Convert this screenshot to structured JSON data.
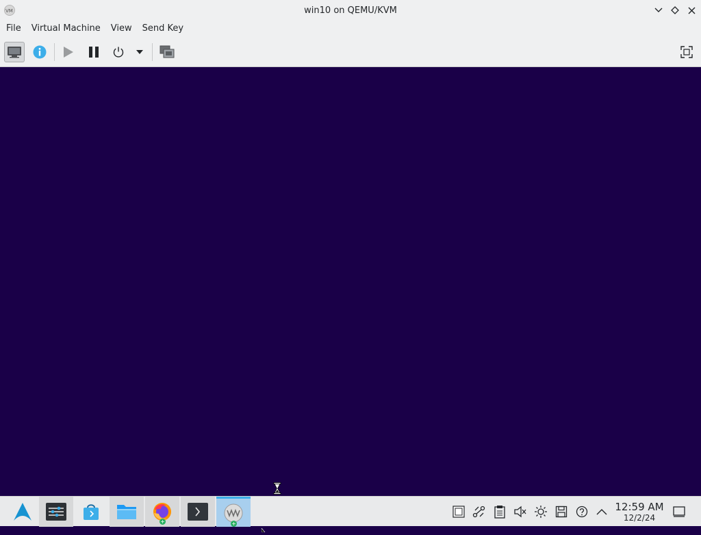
{
  "window": {
    "title": "win10 on QEMU/KVM",
    "app_icon": "virt-manager-icon"
  },
  "menu": {
    "items": [
      "File",
      "Virtual Machine",
      "View",
      "Send Key"
    ]
  },
  "toolbar": {
    "buttons": [
      {
        "name": "console",
        "icon": "monitor-icon",
        "active": true
      },
      {
        "name": "details",
        "icon": "info-icon"
      },
      {
        "name": "run",
        "icon": "play-icon"
      },
      {
        "name": "pause",
        "icon": "pause-icon"
      },
      {
        "name": "shutdown",
        "icon": "power-icon"
      },
      {
        "name": "shutdown-menu",
        "icon": "chevron-down-icon"
      },
      {
        "name": "snapshots",
        "icon": "snapshot-icon"
      },
      {
        "name": "fullscreen",
        "icon": "fullscreen-icon"
      }
    ]
  },
  "vm_display": {
    "background": "#1a0048",
    "cursor": "hourglass-icon"
  },
  "taskbar": {
    "launcher": "application-launcher-icon",
    "tasks": [
      {
        "name": "system-settings",
        "icon": "settings-sliders-icon"
      },
      {
        "name": "discover",
        "icon": "store-bag-icon"
      },
      {
        "name": "file-manager",
        "icon": "folder-icon"
      },
      {
        "name": "firefox",
        "icon": "firefox-icon"
      },
      {
        "name": "terminal",
        "icon": "terminal-icon"
      },
      {
        "name": "virt-manager",
        "icon": "virt-manager-icon"
      }
    ],
    "tray": [
      "clipboard-icon",
      "network-icon",
      "notes-icon",
      "volume-muted-icon",
      "brightness-icon",
      "storage-icon",
      "help-icon",
      "expand-up-icon"
    ],
    "clock": {
      "time": "12:59 AM",
      "date": "12/2/24"
    },
    "show_desktop": "show-desktop-icon"
  },
  "colors": {
    "chrome": "#eff0f1",
    "accent": "#3daee9",
    "vm_bg": "#1a0048"
  }
}
